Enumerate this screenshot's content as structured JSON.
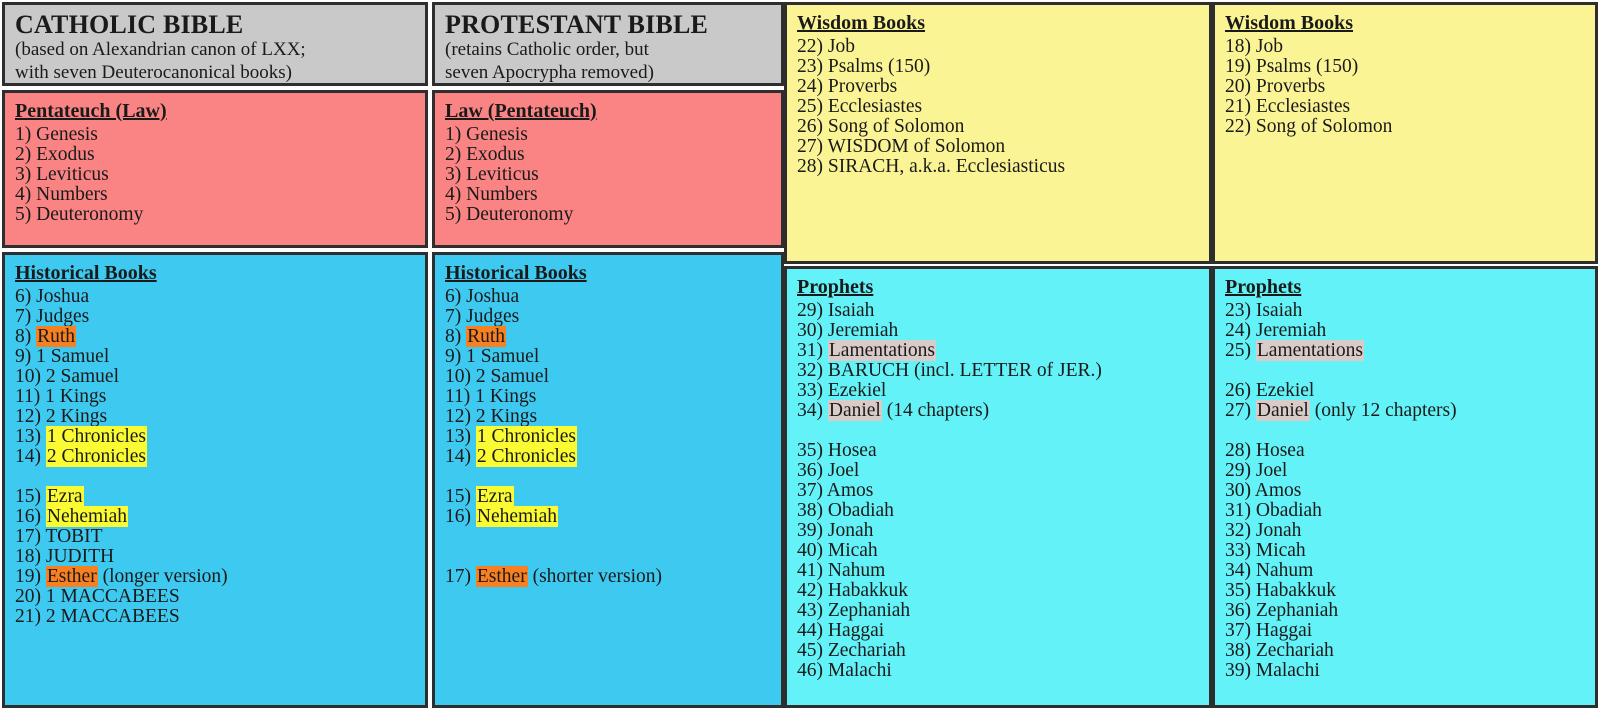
{
  "colors": {
    "header_fill": "#c9c9c9",
    "pentateuch_fill": "#fa8484",
    "historical_fill": "#3ec9f0",
    "wisdom_fill": "#fbf494",
    "prophets_fill": "#63f2f7",
    "highlight_orange": "#f98020",
    "highlight_yellow": "#fbfb33",
    "highlight_rose": "#d9ccc8",
    "border": "#2e2e2e"
  },
  "catholic": {
    "header": {
      "title": "CATHOLIC BIBLE",
      "subtitle_line1": "(based on Alexandrian canon of LXX;",
      "subtitle_line2": "with seven Deuterocanonical books)"
    },
    "law": {
      "heading": "Pentateuch (Law)",
      "items": [
        "1) Genesis",
        "2) Exodus",
        "3) Leviticus",
        "4) Numbers",
        "5) Deuteronomy"
      ]
    },
    "historical": {
      "heading": "Historical Books",
      "items": [
        "6) Joshua",
        "7) Judges",
        "8) Ruth",
        "9) 1 Samuel",
        "10) 2 Samuel",
        "11) 1 Kings",
        "12) 2 Kings",
        "13) 1 Chronicles",
        "14) 2 Chronicles",
        "",
        "15) Ezra",
        "16) Nehemiah",
        "17) TOBIT",
        "18) JUDITH",
        "19) Esther (longer version)",
        "20) 1 MACCABEES",
        "21) 2 MACCABEES"
      ]
    }
  },
  "protestant": {
    "header": {
      "title": "PROTESTANT BIBLE",
      "subtitle_line1": "(retains Catholic order, but",
      "subtitle_line2": "seven Apocrypha removed)"
    },
    "law": {
      "heading": "Law (Pentateuch)",
      "items": [
        "1) Genesis",
        "2) Exodus",
        "3) Leviticus",
        "4) Numbers",
        "5) Deuteronomy"
      ]
    },
    "historical": {
      "heading": "Historical Books",
      "items": [
        "6) Joshua",
        "7) Judges",
        "8) Ruth",
        "9) 1 Samuel",
        "10) 2 Samuel",
        "11) 1 Kings",
        "12) 2 Kings",
        "13) 1 Chronicles",
        "14) 2 Chronicles",
        "",
        "15) Ezra",
        "16) Nehemiah",
        "",
        "",
        "17) Esther (shorter version)"
      ]
    }
  },
  "catholic_right": {
    "wisdom": {
      "heading": "Wisdom Books",
      "items": [
        "22) Job",
        "23) Psalms (150)",
        "24) Proverbs",
        "25) Ecclesiastes",
        "26) Song of Solomon",
        "27) WISDOM of Solomon",
        "28) SIRACH, a.k.a. Ecclesiasticus"
      ]
    },
    "prophets": {
      "heading": "Prophets",
      "items": [
        "29) Isaiah",
        "30) Jeremiah",
        "31) Lamentations",
        "32) BARUCH (incl. LETTER of JER.)",
        "33) Ezekiel",
        "34) Daniel (14 chapters)",
        "",
        "35) Hosea",
        "36) Joel",
        "37) Amos",
        "38) Obadiah",
        "39) Jonah",
        "40) Micah",
        "41) Nahum",
        "42) Habakkuk",
        "43) Zephaniah",
        "44) Haggai",
        "45) Zechariah",
        "46) Malachi"
      ]
    }
  },
  "protestant_right": {
    "wisdom": {
      "heading": "Wisdom Books",
      "items": [
        "18) Job",
        "19) Psalms (150)",
        "20) Proverbs",
        "21) Ecclesiastes",
        "22) Song of Solomon"
      ]
    },
    "prophets": {
      "heading": "Prophets",
      "items": [
        "23) Isaiah",
        "24) Jeremiah",
        "25) Lamentations",
        "",
        "26) Ezekiel",
        "27) Daniel (only 12 chapters)",
        "",
        "28) Hosea",
        "29) Joel",
        "30) Amos",
        "31) Obadiah",
        "32) Jonah",
        "33) Micah",
        "34) Nahum",
        "35) Habakkuk",
        "36) Zephaniah",
        "37) Haggai",
        "38) Zechariah",
        "39) Malachi"
      ]
    }
  },
  "highlights": {
    "catholic.historical": {
      "2": {
        "text": "Ruth",
        "style": "hl-orange"
      },
      "7": {
        "text": "1 Chronicles",
        "style": "hl-yellow"
      },
      "8": {
        "text": "2 Chronicles",
        "style": "hl-yellow"
      },
      "10": {
        "text": "Ezra",
        "style": "hl-yellow"
      },
      "11": {
        "text": "Nehemiah",
        "style": "hl-yellow"
      },
      "14": {
        "text": "Esther",
        "style": "hl-orange"
      }
    },
    "protestant.historical": {
      "2": {
        "text": "Ruth",
        "style": "hl-orange"
      },
      "7": {
        "text": "1 Chronicles",
        "style": "hl-yellow"
      },
      "8": {
        "text": "2 Chronicles",
        "style": "hl-yellow"
      },
      "10": {
        "text": "Ezra",
        "style": "hl-yellow"
      },
      "11": {
        "text": "Nehemiah",
        "style": "hl-yellow"
      },
      "14": {
        "text": "Esther",
        "style": "hl-orange"
      }
    },
    "catholic_right.prophets": {
      "2": {
        "text": "Lamentations",
        "style": "hl-rose"
      },
      "5": {
        "text": "Daniel",
        "style": "hl-rose"
      }
    },
    "protestant_right.prophets": {
      "2": {
        "text": "Lamentations",
        "style": "hl-rose"
      },
      "5": {
        "text": "Daniel",
        "style": "hl-rose"
      }
    }
  }
}
